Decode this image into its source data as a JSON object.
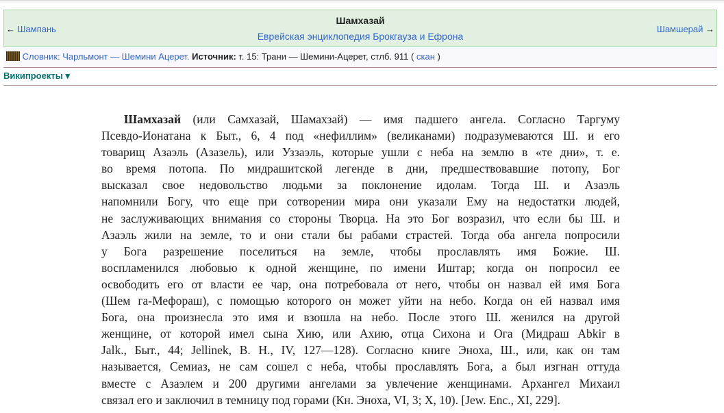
{
  "header": {
    "title": "Шамхазай",
    "subtitle": "Еврейская энциклопедия Брокгауза и Ефрона",
    "prev": "Шампань",
    "next": "Шамшерай",
    "prev_arrow": "←",
    "next_arrow": "→"
  },
  "slovnik": {
    "link": "Словник: Чарльмонт — Шемини Ацерет.",
    "source_label": "Источник:",
    "source": "т. 15: Трани — Шемини-Ацерет, стлб. 911",
    "open": "(",
    "scan": "скан",
    "close": ")"
  },
  "wikiprojects": {
    "label": "Википроекты",
    "arrow": "▾"
  },
  "article": {
    "headword": "Шамхазай",
    "lines": [
      "(или Самхазай, Шамахзай) — имя падшего ангела. Согласно Таргуму",
      "Псевдо-Ионатана к Быт., 6, 4 под «нефиллим» (великанами) подразумеваются Ш. и его",
      "товарищ Азаэль (Азазель), или Уззаэль, которые ушли с неба на землю в «те дни», т. е.",
      "во время потопа. По мидрашитской легенде в дни, предшествовавшие потопу, Бог",
      "высказал свое недовольство людьми за поклонение идолам. Тогда Ш. и Азаэль",
      "напомнили Богу, что еще при сотворении мира они указали Ему на недостатки людей,",
      "не заслуживающих внимания со стороны Творца. На это Бог возразил, что если бы Ш. и",
      "Азаэль жили на земле, то и они стали бы рабами страстей. Тогда оба ангела попросили",
      "у Бога разрешение поселиться на земле, чтобы прославлять имя Божие. Ш.",
      "воспламенился любовью к одной женщине, по имени Иштар; когда он попросил ее",
      "освободить его от власти ее чар, она потребовала от него, чтобы он назвал ей имя Бога",
      "(Шем га-Мефораш), с помощью которого он может уйти на небо. Когда он ей назвал имя",
      "Бога, она произнесла это имя и взошла на небо. После этого Ш. женился на другой",
      "женщине, от которой имел сына Хию, или Ахию, отца Сихона и Ога (Мидраш Abkir в",
      "Jalk., Быт., 44; Jellinek, B. H., IV, 127—128). Согласно книге Эноха, Ш., или, как он там",
      "называется, Семиаз, не сам сошел с неба, чтобы прославлять Бога, а был изгнан оттуда",
      "вместе с Азаэлем и 200 другими ангелами за увлечение женщинами. Архангел Михаил",
      "связал его и заключил в темницу под горами (Кн. Эноха, VI, 3; X, 10). [Jew. Enc., XI, 229]."
    ]
  }
}
